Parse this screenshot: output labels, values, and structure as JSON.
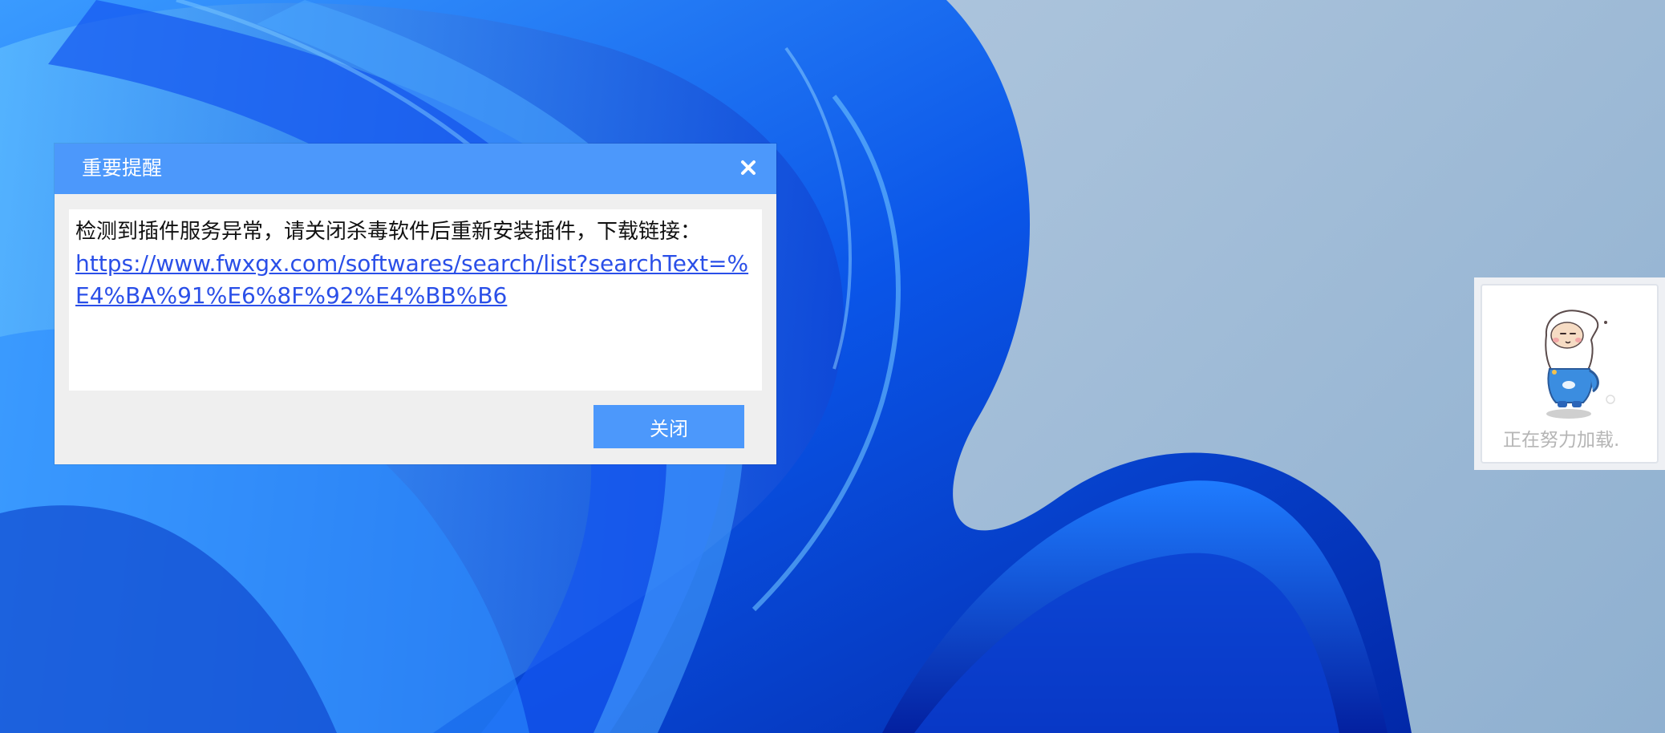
{
  "dialog": {
    "title": "重要提醒",
    "message": "检测到插件服务异常，请关闭杀毒软件后重新安装插件，下载链接：",
    "link_text": "https://www.fwxgx.com/softwares/search/list?searchText=%E4%BA%91%E6%8F%92%E4%BB%B6",
    "close_label": "关闭",
    "close_icon": "close-icon",
    "accent_color": "#4c98fb",
    "link_color": "#2a4fe8"
  },
  "loading": {
    "text": "正在努力加载.",
    "mascot_icon": "mascot-icon"
  }
}
